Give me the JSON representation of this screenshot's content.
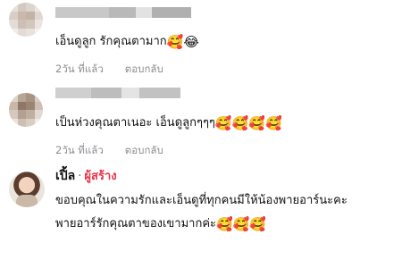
{
  "colors": {
    "meta_gray": "#8a8d91",
    "author_badge": "#e8344a",
    "text": "#111111"
  },
  "comments": [
    {
      "text": "เอ็นดูลูก รักคุณตามาก",
      "emojis": [
        "🥰",
        "😂"
      ],
      "time": "2วัน ที่แล้ว",
      "reply": "ตอบกลับ"
    },
    {
      "text": "เป็นห่วงคุณตาเนอะ เอ็นดูลูกๆๆๆ",
      "emojis": [
        "🥰",
        "🥰",
        "🥰",
        "🥰"
      ],
      "time": "2วัน ที่แล้ว",
      "reply": "ตอบกลับ"
    },
    {
      "name": "เปิ้ล",
      "badge": "ผู้สร้าง",
      "separator": "·",
      "line1": "ขอบคุณในความรักและเอ็นดูที่ทุกคนมีให้น้องพายอาร์นะคะ",
      "line2": "พายอาร์รักคุณตาของเขามากค่ะ",
      "emojis": [
        "🥰",
        "🥰",
        "🥰"
      ]
    }
  ]
}
